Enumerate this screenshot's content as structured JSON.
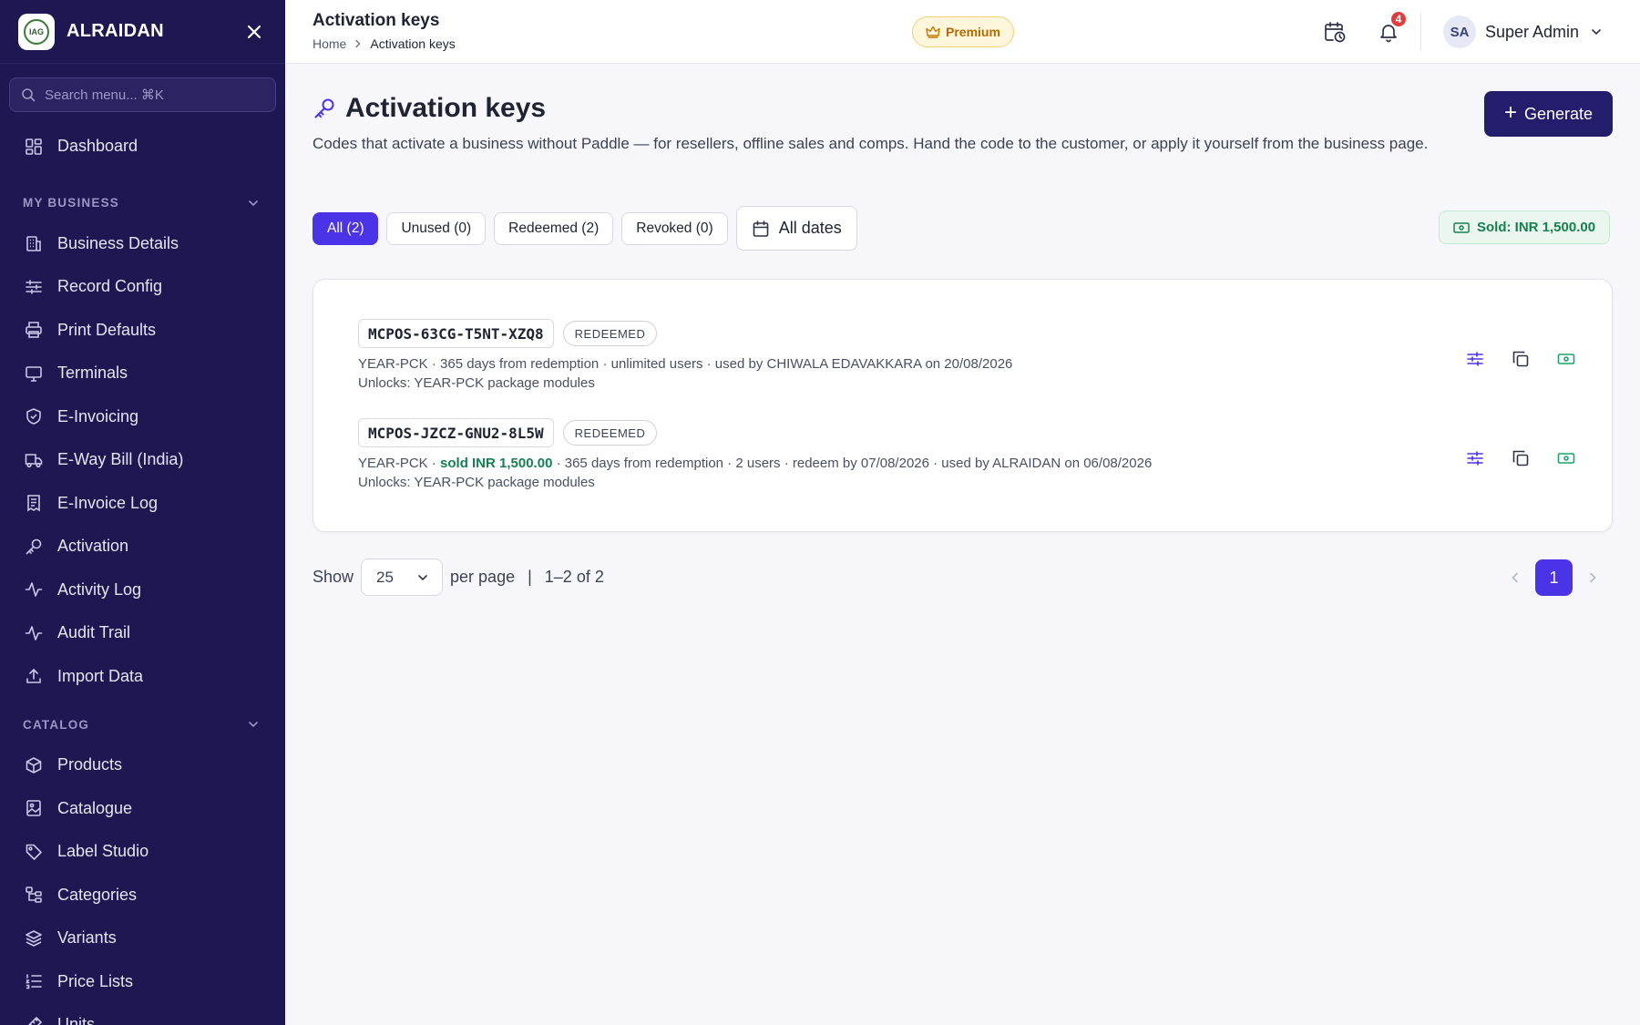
{
  "sidebar": {
    "brand": "ALRAIDAN",
    "logo_text": "IAG",
    "search_placeholder": "Search menu... ⌘K",
    "dashboard": "Dashboard",
    "sections": [
      {
        "title": "MY BUSINESS",
        "items": [
          "Business Details",
          "Record Config",
          "Print Defaults",
          "Terminals",
          "E-Invoicing",
          "E-Way Bill (India)",
          "E-Invoice Log",
          "Activation",
          "Activity Log",
          "Audit Trail",
          "Import Data"
        ]
      },
      {
        "title": "CATALOG",
        "items": [
          "Products",
          "Catalogue",
          "Label Studio",
          "Categories",
          "Variants",
          "Price Lists",
          "Units"
        ]
      }
    ]
  },
  "header": {
    "title": "Activation keys",
    "breadcrumb_home": "Home",
    "breadcrumb_current": "Activation keys",
    "premium": "Premium",
    "notification_count": "4",
    "user_initials": "SA",
    "user_name": "Super Admin"
  },
  "page": {
    "title": "Activation keys",
    "description": "Codes that activate a business without Paddle — for resellers, offline sales and comps. Hand the code to the customer, or apply it yourself from the business page.",
    "generate": "Generate"
  },
  "filters": {
    "tabs": [
      "All (2)",
      "Unused (0)",
      "Redeemed (2)",
      "Revoked (0)"
    ],
    "active_index": 0,
    "dates": "All dates",
    "sold": "Sold: INR 1,500.00"
  },
  "keys": [
    {
      "code": "MCPOS-63CG-T5NT-XZQ8",
      "status": "REDEEMED",
      "meta_pre": "YEAR-PCK · ",
      "sold": "",
      "meta_post": "365 days from redemption · unlimited users · used by CHIWALA EDAVAKKARA on 20/08/2026",
      "unlocks": "Unlocks: YEAR-PCK package modules"
    },
    {
      "code": "MCPOS-JZCZ-GNU2-8L5W",
      "status": "REDEEMED",
      "meta_pre": "YEAR-PCK · ",
      "sold": "sold INR 1,500.00",
      "meta_post": " · 365 days from redemption · 2 users · redeem by 07/08/2026 · used by ALRAIDAN on 06/08/2026",
      "unlocks": "Unlocks: YEAR-PCK package modules"
    }
  ],
  "pagination": {
    "show": "Show",
    "per_page_value": "25",
    "per_page": "per page",
    "separator": "|",
    "range": "1–2 of 2",
    "current_page": "1"
  },
  "colors": {
    "sidebar": "#1e1852",
    "accent": "#4b33e8",
    "generate": "#241d6b",
    "success": "#168150"
  }
}
